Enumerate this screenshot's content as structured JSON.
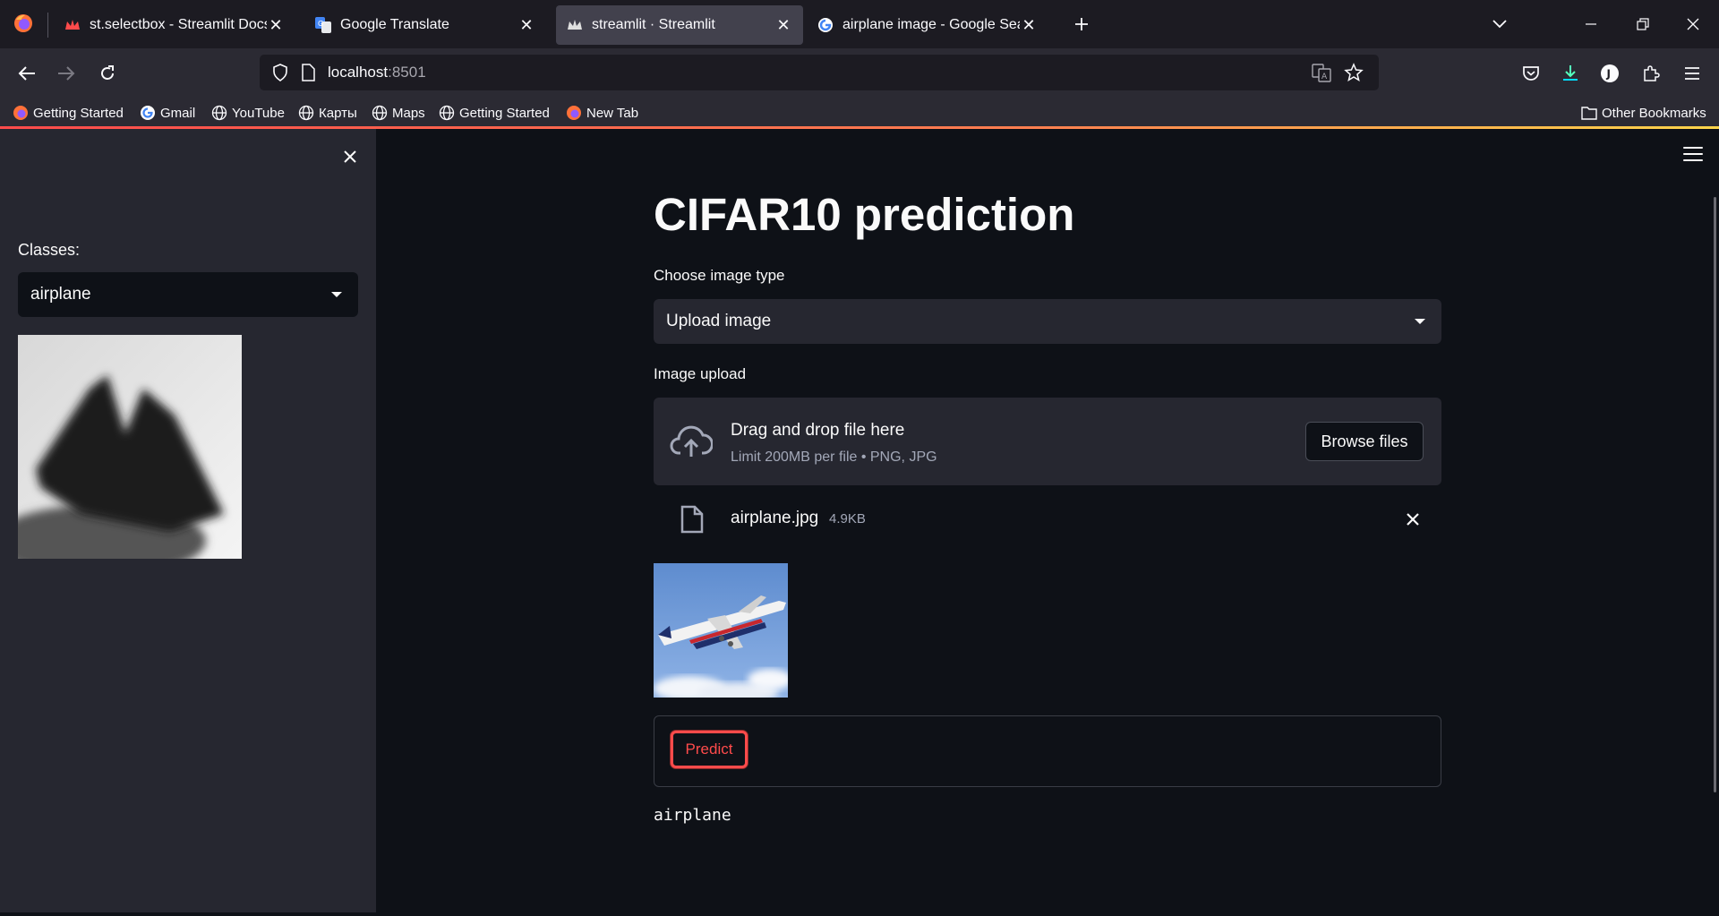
{
  "browser": {
    "tabs": [
      {
        "label": "st.selectbox - Streamlit Docs",
        "active": false
      },
      {
        "label": "Google Translate",
        "active": false
      },
      {
        "label": "streamlit · Streamlit",
        "active": true
      },
      {
        "label": "airplane image - Google Search",
        "active": false
      }
    ],
    "url_host": "localhost",
    "url_port": ":8501",
    "bookmarks": [
      "Getting Started",
      "Gmail",
      "YouTube",
      "Карты",
      "Maps",
      "Getting Started",
      "New Tab"
    ],
    "other_bookmarks": "Other Bookmarks",
    "profile_initial": "J"
  },
  "sidebar": {
    "label": "Classes:",
    "selected": "airplane"
  },
  "main": {
    "title": "CIFAR10 prediction",
    "image_type_label": "Choose image type",
    "image_type_value": "Upload image",
    "upload_label": "Image upload",
    "dropzone_title": "Drag and drop file here",
    "dropzone_sub": "Limit 200MB per file • PNG, JPG",
    "browse_label": "Browse files",
    "file_name": "airplane.jpg",
    "file_size": "4.9KB",
    "predict_label": "Predict",
    "result": "airplane"
  },
  "colors": {
    "accent": "#ff4b4b",
    "background": "#0e1117",
    "secondary_background": "#262730",
    "browser_chrome": "#1c1b22"
  }
}
